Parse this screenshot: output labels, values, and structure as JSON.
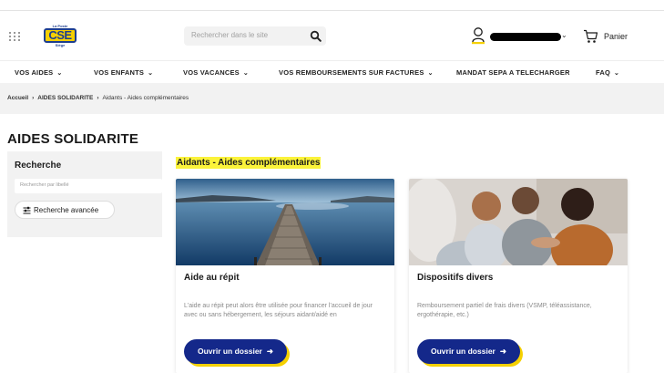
{
  "header": {
    "logo": {
      "top": "La Poste",
      "main": "CSE",
      "bottom": "Siège"
    },
    "search_placeholder": "Rechercher dans le site",
    "cart_label": "Panier"
  },
  "nav": {
    "items": [
      {
        "label": "VOS AIDES",
        "has_dropdown": true
      },
      {
        "label": "VOS ENFANTS",
        "has_dropdown": true
      },
      {
        "label": "VOS VACANCES",
        "has_dropdown": true
      },
      {
        "label": "VOS REMBOURSEMENTS SUR FACTURES",
        "has_dropdown": true
      },
      {
        "label": "MANDAT SEPA A TELECHARGER",
        "has_dropdown": false
      },
      {
        "label": "FAQ",
        "has_dropdown": true
      }
    ]
  },
  "breadcrumb": {
    "items": [
      "Accueil",
      "AIDES SOLIDARITE",
      "Aidants - Aides complémentaires"
    ]
  },
  "page_title": "AIDES SOLIDARITE",
  "sidebar": {
    "title": "Recherche",
    "search_placeholder": "Rechercher par libellé",
    "advanced_label": "Recherche avancée"
  },
  "section_title": "Aidants - Aides complémentaires",
  "cards": [
    {
      "title": "Aide au répit",
      "description": "L'aide au répit peut alors être utilisée pour financer l'accueil de jour avec ou sans hébergement, les séjours aidant/aidé en",
      "button_label": "Ouvrir un dossier"
    },
    {
      "title": "Dispositifs divers",
      "description": "Remboursement partiel de frais divers (VSMP, téléassistance, ergothérapie, etc.)",
      "button_label": "Ouvrir un dossier"
    }
  ],
  "colors": {
    "brand_blue": "#14288a",
    "accent_yellow": "#f5d000",
    "highlight": "#fbf33a"
  }
}
